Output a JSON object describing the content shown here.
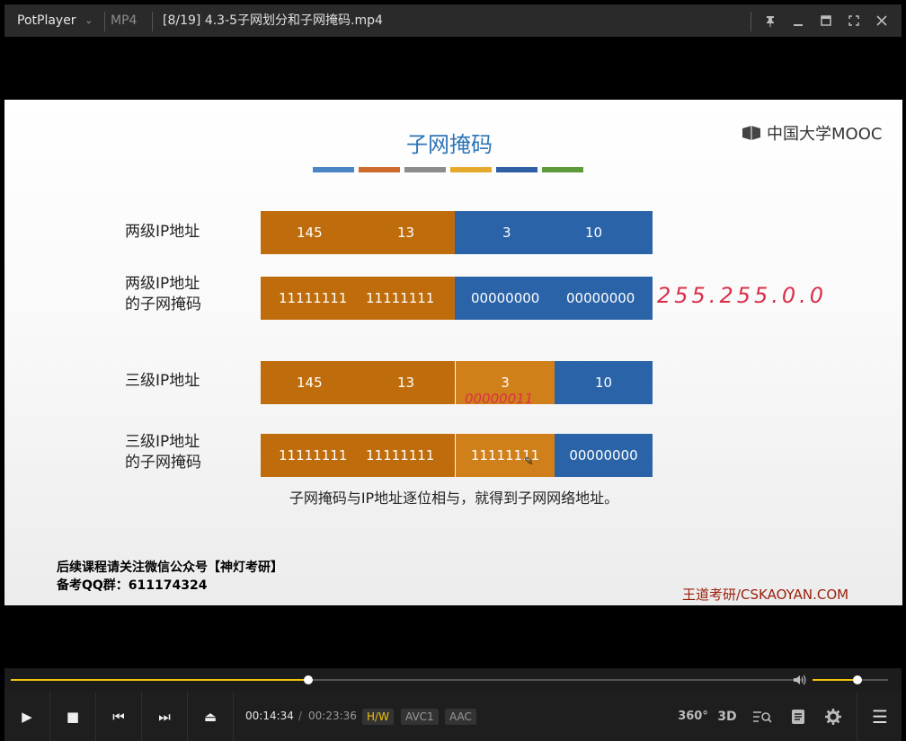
{
  "titlebar": {
    "app_name": "PotPlayer",
    "chevron": "⌄",
    "format": "MP4",
    "title": "[8/19] 4.3-5子网划分和子网掩码.mp4",
    "icons": [
      "pin-icon",
      "minimize-icon",
      "maximize-icon",
      "fullscreen-icon",
      "close-icon"
    ]
  },
  "slide": {
    "title": "子网掩码",
    "accent_colors": [
      "#4a86c5",
      "#cf6b2c",
      "#8c8c8c",
      "#e5a92b",
      "#2f5fa3",
      "#5c9a3a"
    ],
    "logo_text": "中国大学MOOC",
    "rows": [
      {
        "label": "两级IP地址",
        "cells": [
          "145",
          "13",
          "3",
          "10"
        ]
      },
      {
        "label_lines": [
          "两级IP地址",
          "的子网掩码"
        ],
        "cells": [
          "11111111",
          "11111111",
          "00000000",
          "00000000"
        ]
      },
      {
        "label": "三级IP地址",
        "cells": [
          "145",
          "13",
          "3",
          "10"
        ]
      },
      {
        "label_lines": [
          "三级IP地址",
          "的子网掩码"
        ],
        "cells": [
          "11111111",
          "11111111",
          "11111111",
          "00000000"
        ]
      }
    ],
    "handwritten_mask": "255.255.0.0",
    "handwritten_bits": "00000011",
    "caption": "子网掩码与IP地址逐位相与，就得到子网网络地址。",
    "follow_line1": "后续课程请关注微信公众号【神灯考研】",
    "follow_line2": "备考QQ群：611174324",
    "watermark": "王道考研/CSKAOYAN.COM"
  },
  "seekbar": {
    "progress_fraction": 0.375,
    "volume_fraction": 0.6,
    "accent": "#f2c40c"
  },
  "controls": {
    "play": "▶",
    "stop": "■",
    "prev": "⏮",
    "next": "⏭",
    "eject": "⏏",
    "time_current": "00:14:34",
    "time_sep": "/",
    "time_total": "00:23:36",
    "hw": "H/W",
    "video_codec": "AVC1",
    "audio_codec": "AAC",
    "label_360": "360°",
    "label_3d": "3D",
    "menu": "☰"
  }
}
